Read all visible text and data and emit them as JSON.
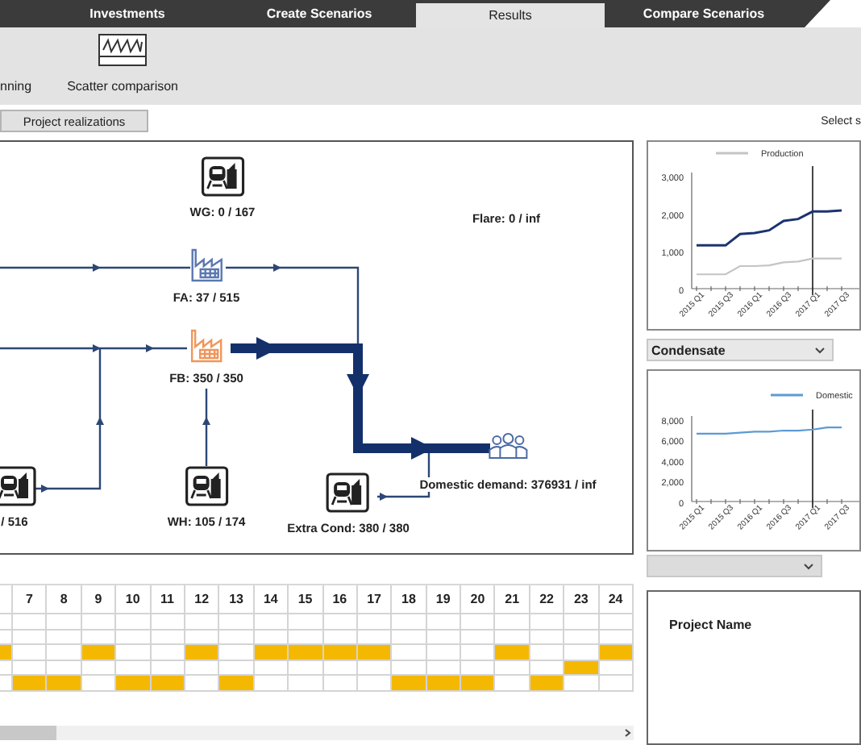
{
  "tabs": [
    {
      "label": "Investments",
      "selected": false
    },
    {
      "label": "Create Scenarios",
      "selected": false
    },
    {
      "label": "Results",
      "selected": true
    },
    {
      "label": "Compare Scenarios",
      "selected": false
    }
  ],
  "ribbon": {
    "items": [
      {
        "kind": "plain",
        "label": "nning"
      },
      {
        "kind": "scatter",
        "label": "Scatter comparison"
      }
    ]
  },
  "toolbar": {
    "button": "Project realizations",
    "select_label": "Select s"
  },
  "diagram": {
    "nodes": [
      {
        "kind": "plant",
        "label": "WG: 0 / 167"
      },
      {
        "kind": "label",
        "label": "Flare: 0 / inf"
      },
      {
        "kind": "facility",
        "full": false,
        "label": "FA: 37 / 515"
      },
      {
        "kind": "facility",
        "full": true,
        "label": "FB: 350 / 350"
      },
      {
        "kind": "plant",
        "label": "/ 516"
      },
      {
        "kind": "plant",
        "label": "WH: 105 / 174"
      },
      {
        "kind": "plant",
        "label": "Extra Cond: 380 / 380"
      },
      {
        "kind": "demand",
        "label": "Domestic demand: 376931 / inf"
      }
    ]
  },
  "charts": [
    {
      "chart_data": {
        "type": "line",
        "categories": [
          "2015 Q1",
          null,
          "2015 Q3",
          null,
          "2016 Q1",
          null,
          "2016 Q3",
          null,
          "2017 Q1",
          null,
          "2017 Q3"
        ],
        "ylim": [
          0,
          3000
        ],
        "yticks": [
          {
            "value": 0,
            "label": "0"
          },
          {
            "value": 1000,
            "label": "1,000"
          },
          {
            "value": 2000,
            "label": "2,000"
          },
          {
            "value": 3000,
            "label": "3,000"
          }
        ],
        "series": [
          {
            "name": "Production",
            "color": "#c4c4c4",
            "values": [
              380,
              380,
              380,
              600,
              600,
              620,
              700,
              720,
              800,
              800,
              800
            ]
          },
          {
            "color": "#1c3370",
            "values": [
              1150,
              1150,
              1150,
              1450,
              1480,
              1550,
              1800,
              1850,
              2050,
              2050,
              2080
            ]
          }
        ]
      }
    },
    {
      "chart_data": {
        "type": "line",
        "categories": [
          "2015 Q1",
          null,
          "2015 Q3",
          null,
          "2016 Q1",
          null,
          "2016 Q3",
          null,
          "2017 Q1",
          null,
          "2017 Q3"
        ],
        "ylim": [
          0,
          8000
        ],
        "yticks": [
          {
            "value": 0,
            "label": "0"
          },
          {
            "value": 2000,
            "label": "2,000"
          },
          {
            "value": 4000,
            "label": "4,000"
          },
          {
            "value": 6000,
            "label": "6,000"
          },
          {
            "value": 8000,
            "label": "8,000"
          }
        ],
        "series": [
          {
            "name": "Domestic",
            "color": "#5b9bd5",
            "values": [
              6600,
              6600,
              6600,
              6700,
              6800,
              6800,
              6900,
              6900,
              7000,
              7200,
              7200
            ]
          }
        ]
      }
    }
  ],
  "product_dropdown": {
    "value": "Condensate"
  },
  "schedule": {
    "columns": [
      "7",
      "8",
      "9",
      "10",
      "11",
      "12",
      "13",
      "14",
      "15",
      "16",
      "17",
      "18",
      "19",
      "20",
      "21",
      "22",
      "23",
      "24"
    ],
    "rows": [
      {
        "filled": [
          false,
          false,
          false,
          false,
          false,
          false,
          false,
          false,
          false,
          false,
          false,
          false,
          false,
          false,
          false,
          false,
          false,
          false,
          false
        ]
      },
      {
        "filled": [
          false,
          false,
          false,
          false,
          false,
          false,
          false,
          false,
          false,
          false,
          false,
          false,
          false,
          false,
          false,
          false,
          false,
          false,
          false
        ]
      },
      {
        "filled": [
          true,
          false,
          false,
          true,
          false,
          false,
          true,
          false,
          true,
          true,
          true,
          true,
          false,
          false,
          false,
          true,
          false,
          false,
          true
        ]
      },
      {
        "filled": [
          false,
          false,
          false,
          false,
          false,
          false,
          false,
          false,
          false,
          false,
          false,
          false,
          false,
          false,
          false,
          false,
          false,
          true,
          false
        ]
      },
      {
        "filled": [
          false,
          true,
          true,
          false,
          true,
          true,
          false,
          true,
          false,
          false,
          false,
          false,
          true,
          true,
          true,
          false,
          true,
          false,
          false
        ]
      }
    ]
  },
  "project_panel": {
    "heading": "Project Name"
  }
}
